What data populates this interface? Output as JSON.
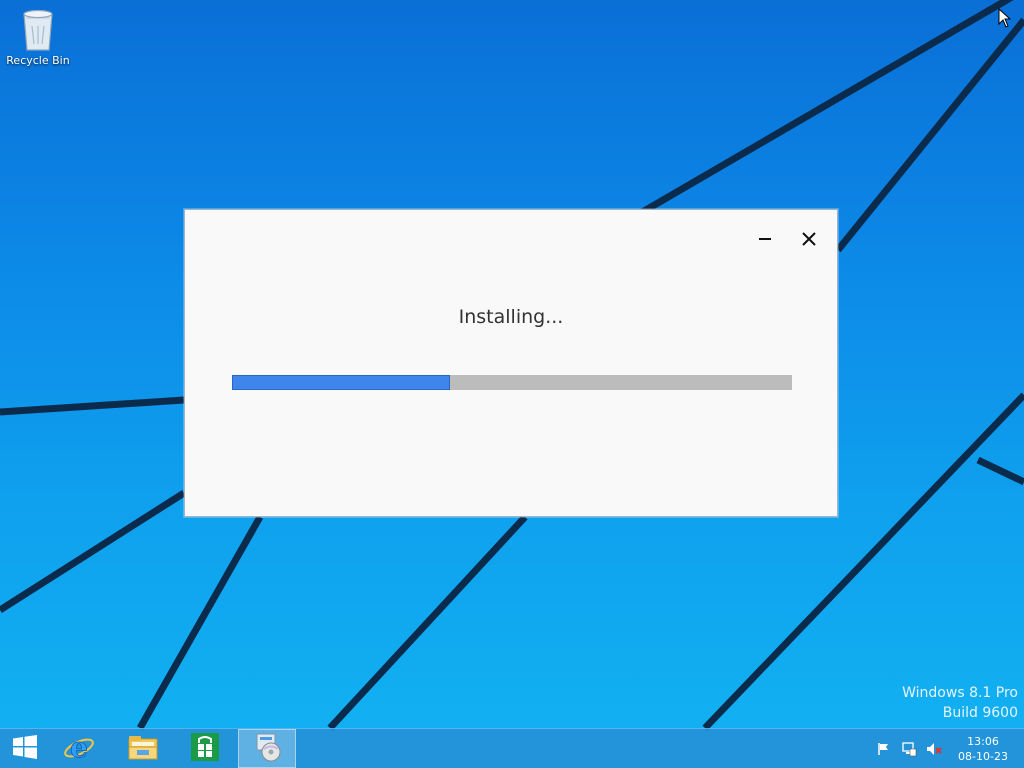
{
  "desktop": {
    "icons": [
      {
        "label": "Recycle Bin",
        "icon": "recycle-bin-icon"
      }
    ],
    "watermark": {
      "line1": "Windows 8.1 Pro",
      "line2": "Build 9600"
    }
  },
  "dialog": {
    "status": "Installing...",
    "progress_fraction": 0.39,
    "controls": {
      "minimize": "minimize-icon",
      "close": "close-icon"
    },
    "colors": {
      "progress_fill": "#3f86ec",
      "progress_track": "#bcbcbc",
      "background": "#f9f9f9"
    }
  },
  "taskbar": {
    "start": "windows-logo-icon",
    "pinned": [
      {
        "icon": "internet-explorer-icon"
      },
      {
        "icon": "file-explorer-icon"
      },
      {
        "icon": "store-icon"
      },
      {
        "icon": "installer-icon",
        "active": true
      }
    ],
    "tray": [
      "action-center-flag-icon",
      "network-icon",
      "volume-muted-icon"
    ],
    "clock": {
      "time": "13:06",
      "date": "08-10-23"
    }
  },
  "colors": {
    "desktop_top": "#0a6fd6",
    "desktop_bottom": "#12b3f2",
    "taskbar": "#288cd2"
  }
}
